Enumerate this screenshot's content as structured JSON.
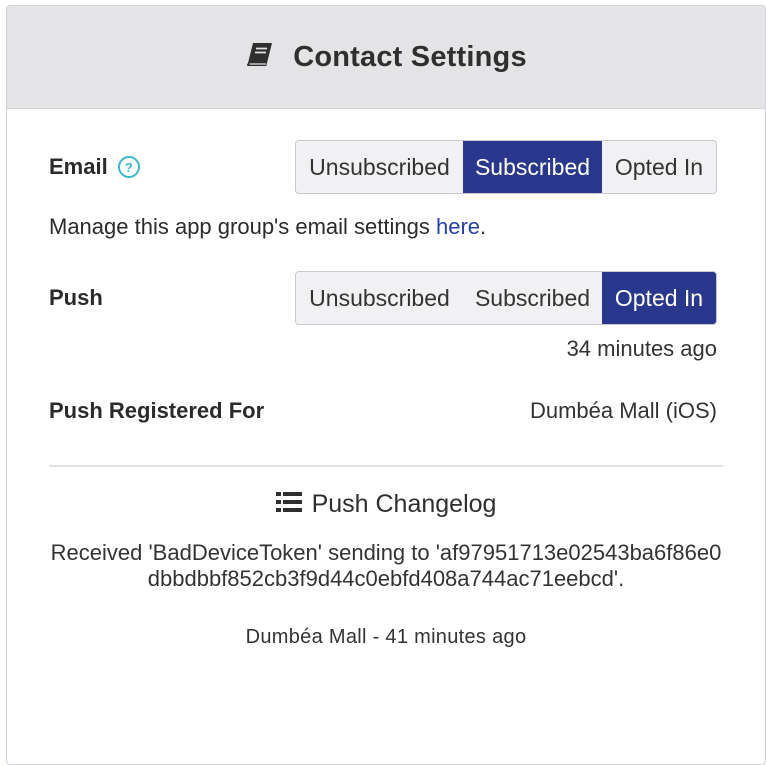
{
  "header": {
    "title": "Contact Settings",
    "icon": "book-icon"
  },
  "email": {
    "label": "Email",
    "help_icon": "?",
    "options": [
      "Unsubscribed",
      "Subscribed",
      "Opted In"
    ],
    "selected": "Subscribed",
    "manage_text": "Manage this app group's email settings ",
    "manage_link": "here",
    "manage_suffix": "."
  },
  "push": {
    "label": "Push",
    "options": [
      "Unsubscribed",
      "Subscribed",
      "Opted In"
    ],
    "selected": "Opted In",
    "updated": "34 minutes ago"
  },
  "push_registered": {
    "label": "Push Registered For",
    "value": "Dumbéa Mall (iOS)"
  },
  "changelog": {
    "title": "Push Changelog",
    "icon": "list-icon",
    "message": "Received 'BadDeviceToken' sending to 'af97951713e02543ba6f86e0dbbdbbf852cb3f9d44c0ebfd408a744ac71eebcd'.",
    "meta": "Dumbéa Mall - 41 minutes ago"
  },
  "colors": {
    "active_segment": "#29378c",
    "link": "#2640a8",
    "help": "#3bb9c6",
    "header_bg": "#e4e4e7"
  }
}
